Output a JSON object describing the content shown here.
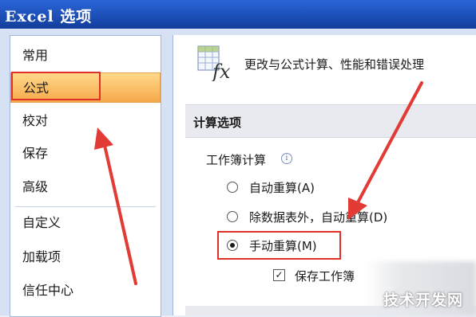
{
  "window": {
    "title": "Excel 选项"
  },
  "sidebar": {
    "items": [
      {
        "label": "常用"
      },
      {
        "label": "公式",
        "selected": true
      },
      {
        "label": "校对"
      },
      {
        "label": "保存"
      },
      {
        "label": "高级"
      },
      {
        "label": "自定义"
      },
      {
        "label": "加载项"
      },
      {
        "label": "信任中心"
      }
    ]
  },
  "header": {
    "icon": "formula-fx-icon",
    "text": "更改与公式计算、性能和错误处理"
  },
  "calc": {
    "section_title": "计算选项",
    "group_label": "工作簿计算",
    "info_glyph": "i",
    "options": [
      {
        "label": "自动重算(A)",
        "checked": false
      },
      {
        "label": "除数据表外，自动重算(D)",
        "checked": false
      },
      {
        "label": "手动重算(M)",
        "checked": true
      }
    ],
    "checkbox": {
      "label": "保存工作簿",
      "checked": true
    }
  },
  "annotations": {
    "color": "#e0302a"
  },
  "watermark": {
    "text": "技术开发网"
  }
}
